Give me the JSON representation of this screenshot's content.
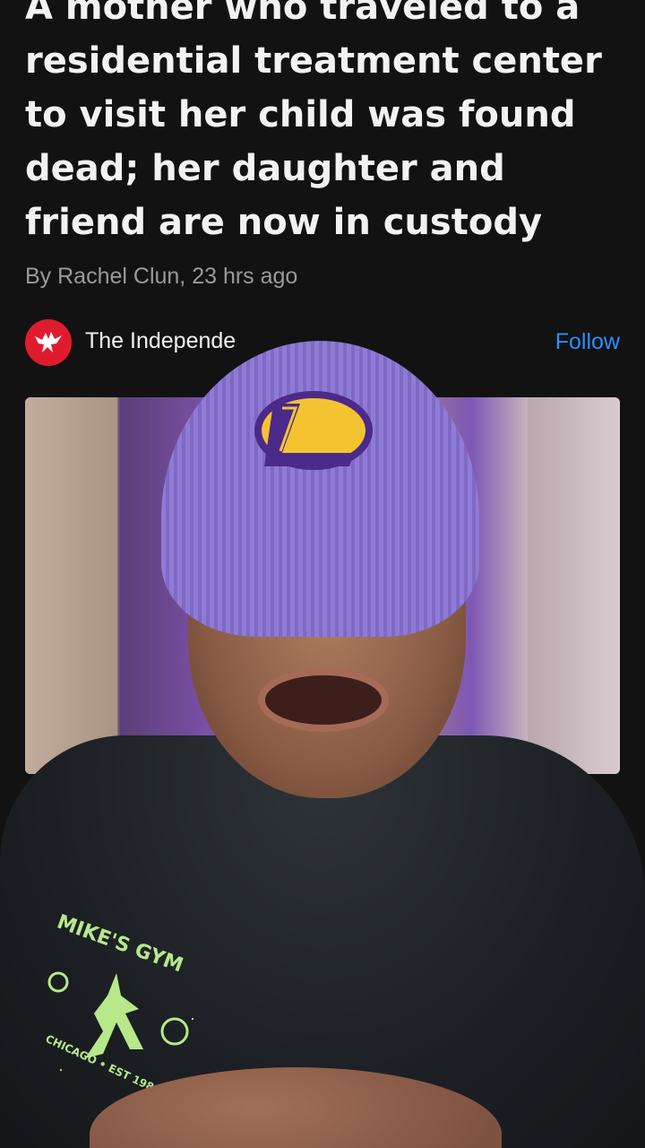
{
  "article": {
    "headline": "A mother who traveled to a residential treatment center to visit her child was found dead; her daughter and friend are now in custody",
    "byline": "By Rachel Clun, 23 hrs ago"
  },
  "source": {
    "name": "The Independe",
    "logo_icon": "eagle-icon",
    "logo_color": "#e11b2e",
    "follow_label": "Follow",
    "follow_color": "#2f8cff"
  },
  "overlay": {
    "shirt_print": "MIKE'S GYM",
    "shirt_print_sub": "CHICAGO • EST 1984"
  }
}
